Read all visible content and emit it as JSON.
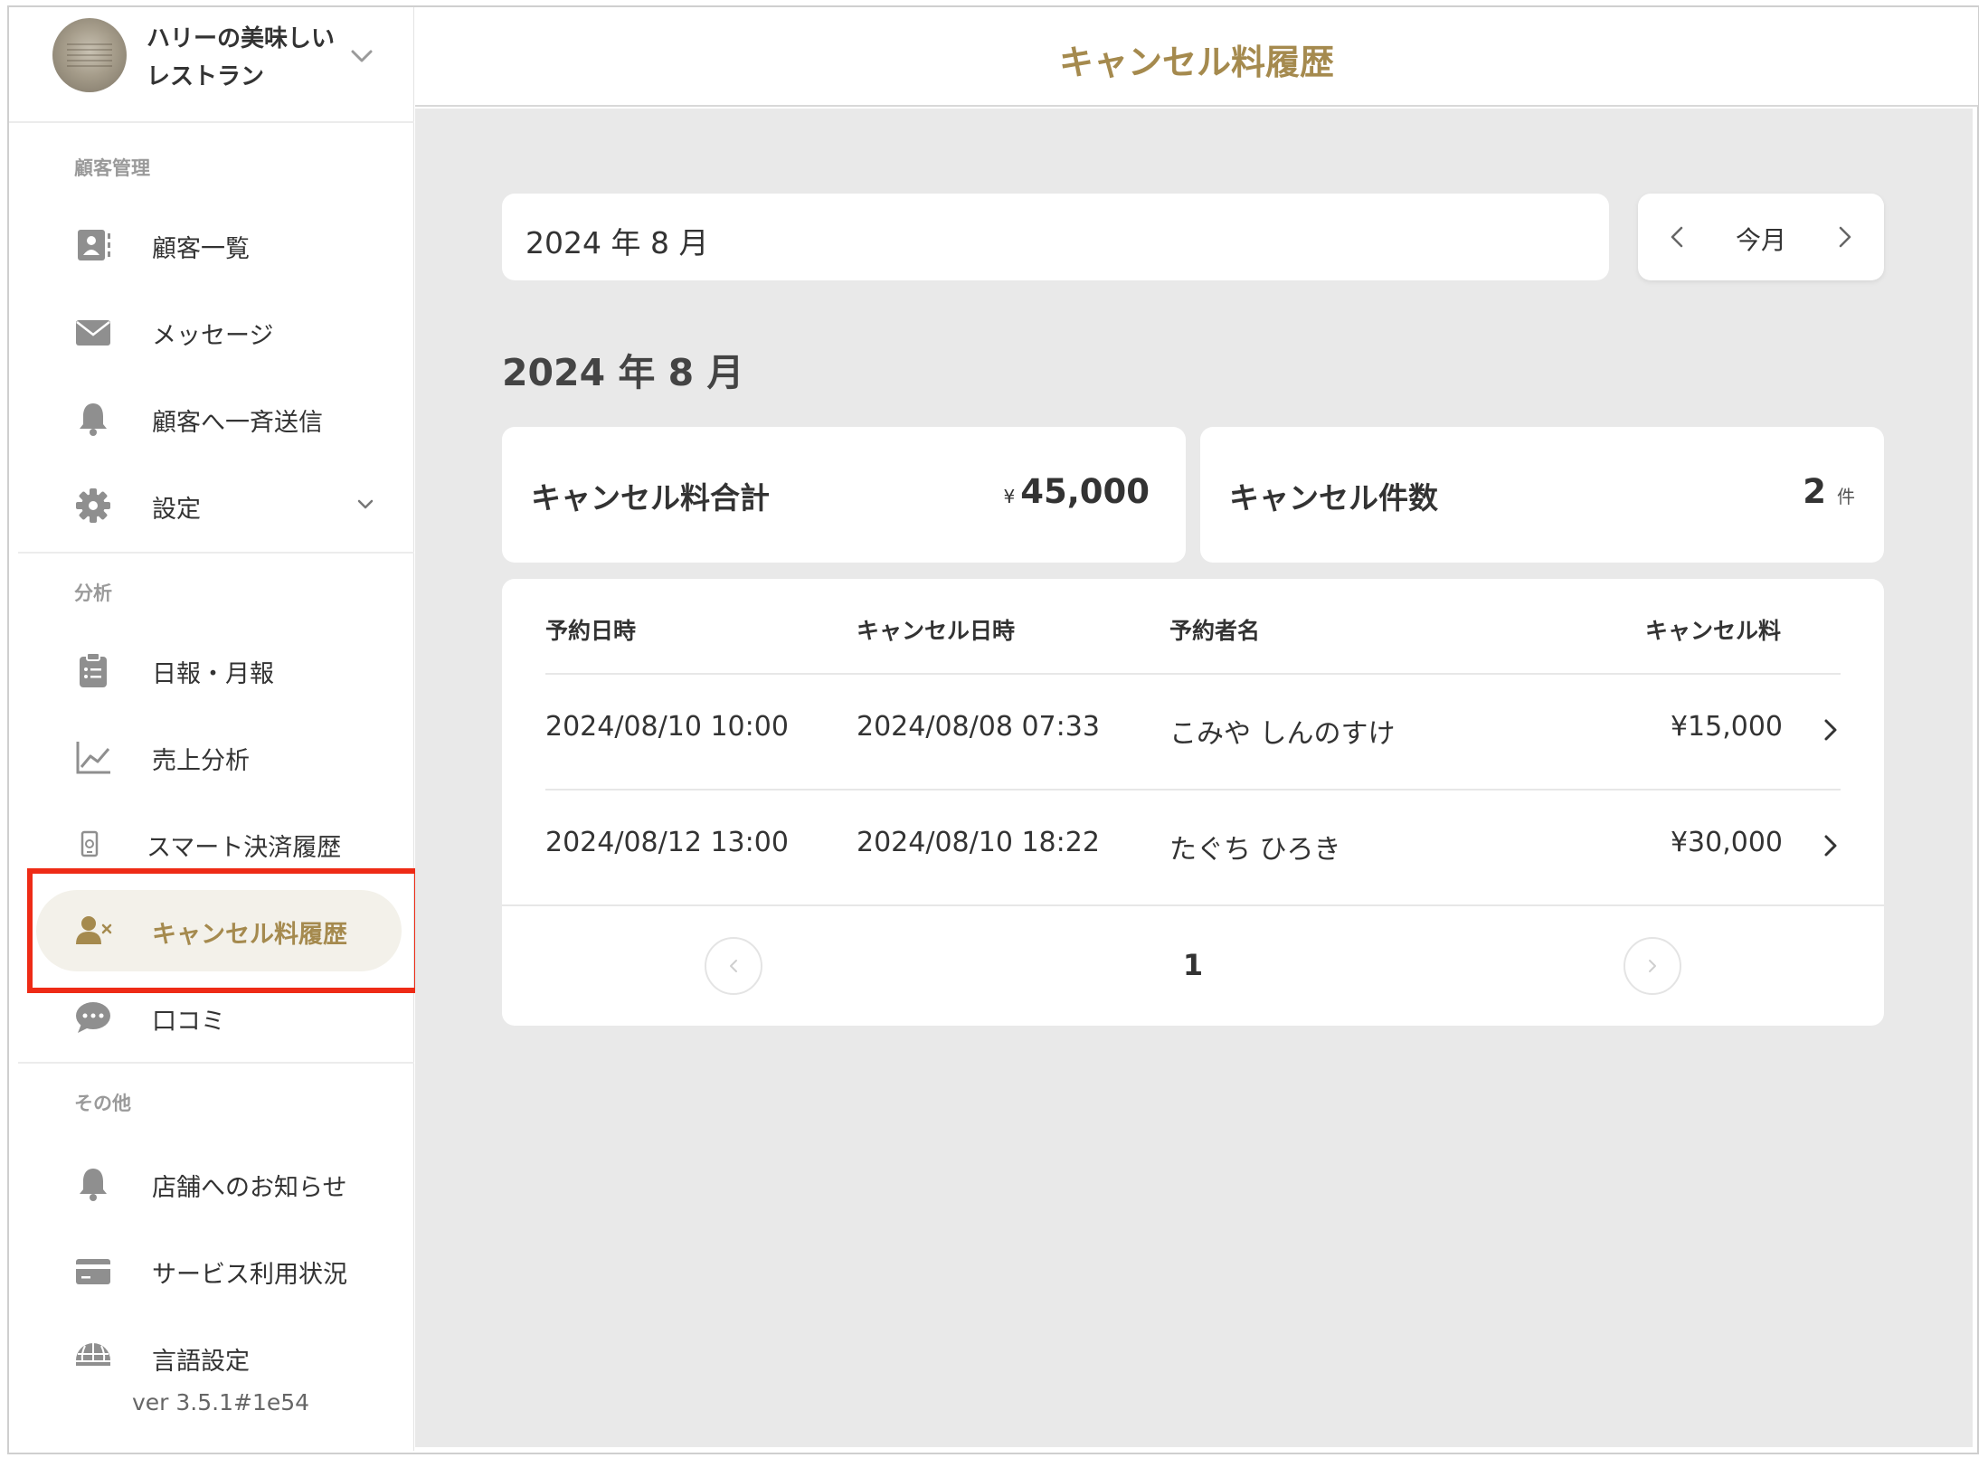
{
  "store": {
    "name": "ハリーの美味しいレストラン"
  },
  "header": {
    "title": "キャンセル料履歴"
  },
  "sidebar": {
    "sections": {
      "customer": "顧客管理",
      "analysis": "分析",
      "other": "その他"
    },
    "items": {
      "customers": "顧客一覧",
      "messages": "メッセージ",
      "broadcast": "顧客へ一斉送信",
      "settings": "設定",
      "daily_monthly": "日報・月報",
      "sales": "売上分析",
      "smart_payment": "スマート決済履歴",
      "cancel_fee": "キャンセル料履歴",
      "reviews": "口コミ",
      "notices": "店舗へのお知らせ",
      "service_usage": "サービス利用状況",
      "language": "言語設定"
    },
    "active_item": "キャンセル料履歴",
    "version": "ver 3.5.1#1e54"
  },
  "main": {
    "month_input_value": "2024 年 8 月",
    "today_label": "今月",
    "month_heading": "2024 年 8 月",
    "stats": {
      "total_title": "キャンセル料合計",
      "total_currency": "¥",
      "total_value": "45,000",
      "count_title": "キャンセル件数",
      "count_value": "2",
      "count_unit": "件"
    },
    "table": {
      "columns": [
        "予約日時",
        "キャンセル日時",
        "予約者名",
        "キャンセル料"
      ],
      "rows": [
        {
          "reserved": "2024/08/10 10:00",
          "cancelled": "2024/08/08 07:33",
          "name": "こみや しんのすけ",
          "fee": "¥15,000"
        },
        {
          "reserved": "2024/08/12 13:00",
          "cancelled": "2024/08/10 18:22",
          "name": "たぐち ひろき",
          "fee": "¥30,000"
        }
      ]
    },
    "pagination": {
      "current": "1"
    }
  },
  "colors": {
    "accent": "#a58a4e",
    "highlight": "#ee2b16",
    "active_bg": "#f3f1ea",
    "main_bg": "#e9e9e9"
  }
}
